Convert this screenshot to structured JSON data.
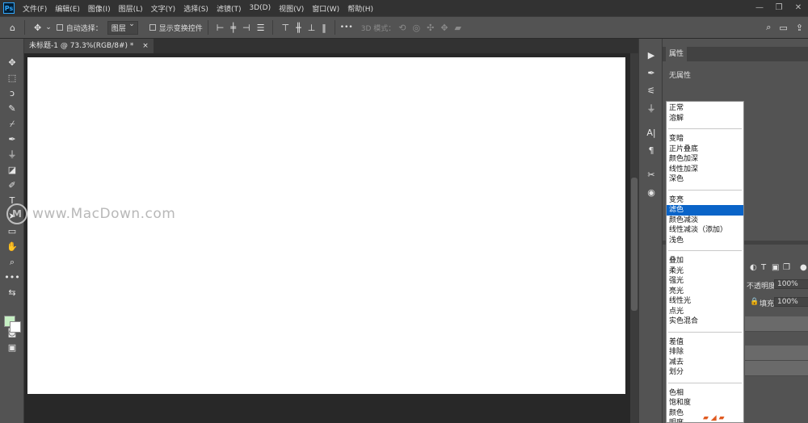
{
  "app": {
    "logo_text": "Ps"
  },
  "menu": [
    "文件(F)",
    "编辑(E)",
    "图像(I)",
    "图层(L)",
    "文字(Y)",
    "选择(S)",
    "滤镜(T)",
    "3D(D)",
    "视图(V)",
    "窗口(W)",
    "帮助(H)"
  ],
  "window_controls": {
    "minimize": "—",
    "restore": "❐",
    "close": "✕"
  },
  "options": {
    "auto_select_label": "自动选择：",
    "layer_select": "图层",
    "show_transform_label": "显示变换控件",
    "more": "•••",
    "mode_3d_label": "3D 模式："
  },
  "document": {
    "tab_title": "未标题-1 @ 73.3%(RGB/8#) *",
    "close": "×"
  },
  "panel": {
    "tab": "属性",
    "no_properties": "无属性"
  },
  "layers": {
    "opacity_label": "不透明度:",
    "opacity_value": "100%",
    "fill_label": "填充:",
    "fill_value": "100%"
  },
  "blend_modes": {
    "groups": [
      [
        "正常",
        "溶解"
      ],
      [
        "变暗",
        "正片叠底",
        "颜色加深",
        "线性加深",
        "深色"
      ],
      [
        "变亮",
        "滤色",
        "颜色减淡",
        "线性减淡（添加）",
        "浅色"
      ],
      [
        "叠加",
        "柔光",
        "强光",
        "亮光",
        "线性光",
        "点光",
        "实色混合"
      ],
      [
        "差值",
        "排除",
        "减去",
        "划分"
      ],
      [
        "色相",
        "饱和度",
        "颜色",
        "明度"
      ]
    ],
    "selected": "滤色"
  },
  "watermark": {
    "logo": "M",
    "text": "www.MacDown.com"
  },
  "colors": {
    "foreground": "#c6f0c4",
    "background": "#ffffff",
    "selection": "#0a64c8"
  }
}
